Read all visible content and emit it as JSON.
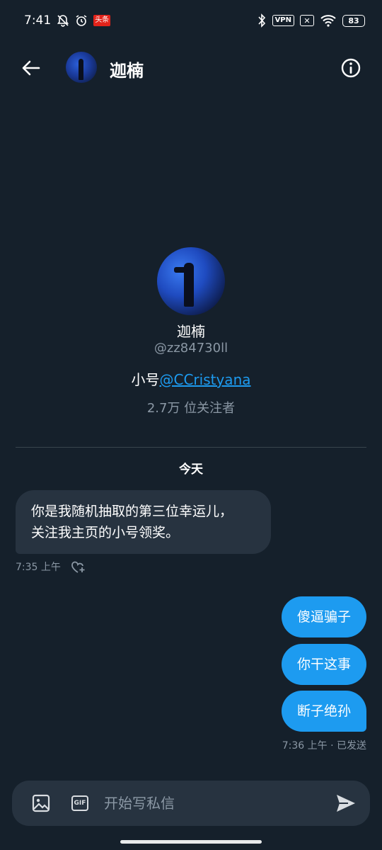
{
  "status_bar": {
    "time": "7:41",
    "news_badge": "头条",
    "vpn_label": "VPN",
    "x_label": "✕",
    "battery": "83"
  },
  "header": {
    "title": "迦楠"
  },
  "profile": {
    "name": "迦楠",
    "handle": "@zz84730ll",
    "bio_prefix": "小号",
    "bio_link": "@CCristyana",
    "followers": "2.7万 位关注者"
  },
  "conversation": {
    "date_label": "今天",
    "received": {
      "line1": "你是我随机抽取的第三位幸运儿，",
      "line2": "关注我主页的小号领奖。",
      "timestamp": "7:35 上午"
    },
    "sent": [
      {
        "text": "傻逼骗子"
      },
      {
        "text": "你干这事"
      },
      {
        "text": "断子绝孙"
      }
    ],
    "sent_meta": "7:36 上午 · 已发送"
  },
  "composer": {
    "placeholder": "开始写私信",
    "gif_label": "GIF"
  },
  "colors": {
    "background": "#15202b",
    "bubble_in": "#273340",
    "accent": "#1d9bf0",
    "muted": "#8b98a5"
  }
}
